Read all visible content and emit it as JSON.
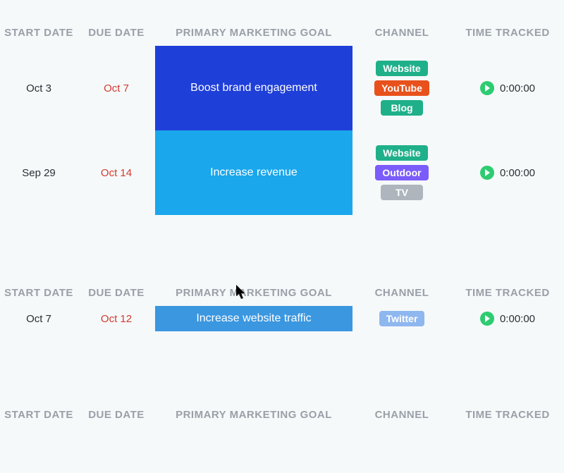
{
  "columns": {
    "start_date": "START DATE",
    "due_date": "DUE DATE",
    "goal": "PRIMARY MARKETING GOAL",
    "channel": "CHANNEL",
    "time": "TIME TRACKED"
  },
  "colors": {
    "goal_dark_blue": "#1f3fd9",
    "goal_light_blue": "#1aa7ec",
    "goal_medium_blue": "#3a97e0",
    "tag_green": "#1fb08a",
    "tag_orange": "#e8511c",
    "tag_purple": "#7b5cfa",
    "tag_grey": "#aeb5bd",
    "tag_lightblue": "#8fb7ef"
  },
  "groups": [
    {
      "rows": [
        {
          "start_date": "Oct 3",
          "due_date": "Oct 7",
          "goal": "Boost brand engagement",
          "goal_color_key": "goal_dark_blue",
          "channels": [
            {
              "label": "Website",
              "color_key": "tag_green"
            },
            {
              "label": "YouTube",
              "color_key": "tag_orange"
            },
            {
              "label": "Blog",
              "color_key": "tag_green"
            }
          ],
          "time": "0:00:00"
        },
        {
          "start_date": "Sep 29",
          "due_date": "Oct 14",
          "goal": "Increase revenue",
          "goal_color_key": "goal_light_blue",
          "channels": [
            {
              "label": "Website",
              "color_key": "tag_green"
            },
            {
              "label": "Outdoor",
              "color_key": "tag_purple"
            },
            {
              "label": "TV",
              "color_key": "tag_grey"
            }
          ],
          "time": "0:00:00"
        }
      ]
    },
    {
      "rows": [
        {
          "start_date": "Oct 7",
          "due_date": "Oct 12",
          "goal": "Increase website traffic",
          "goal_color_key": "goal_medium_blue",
          "channels": [
            {
              "label": "Twitter",
              "color_key": "tag_lightblue"
            }
          ],
          "time": "0:00:00"
        }
      ]
    },
    {
      "rows": []
    }
  ]
}
